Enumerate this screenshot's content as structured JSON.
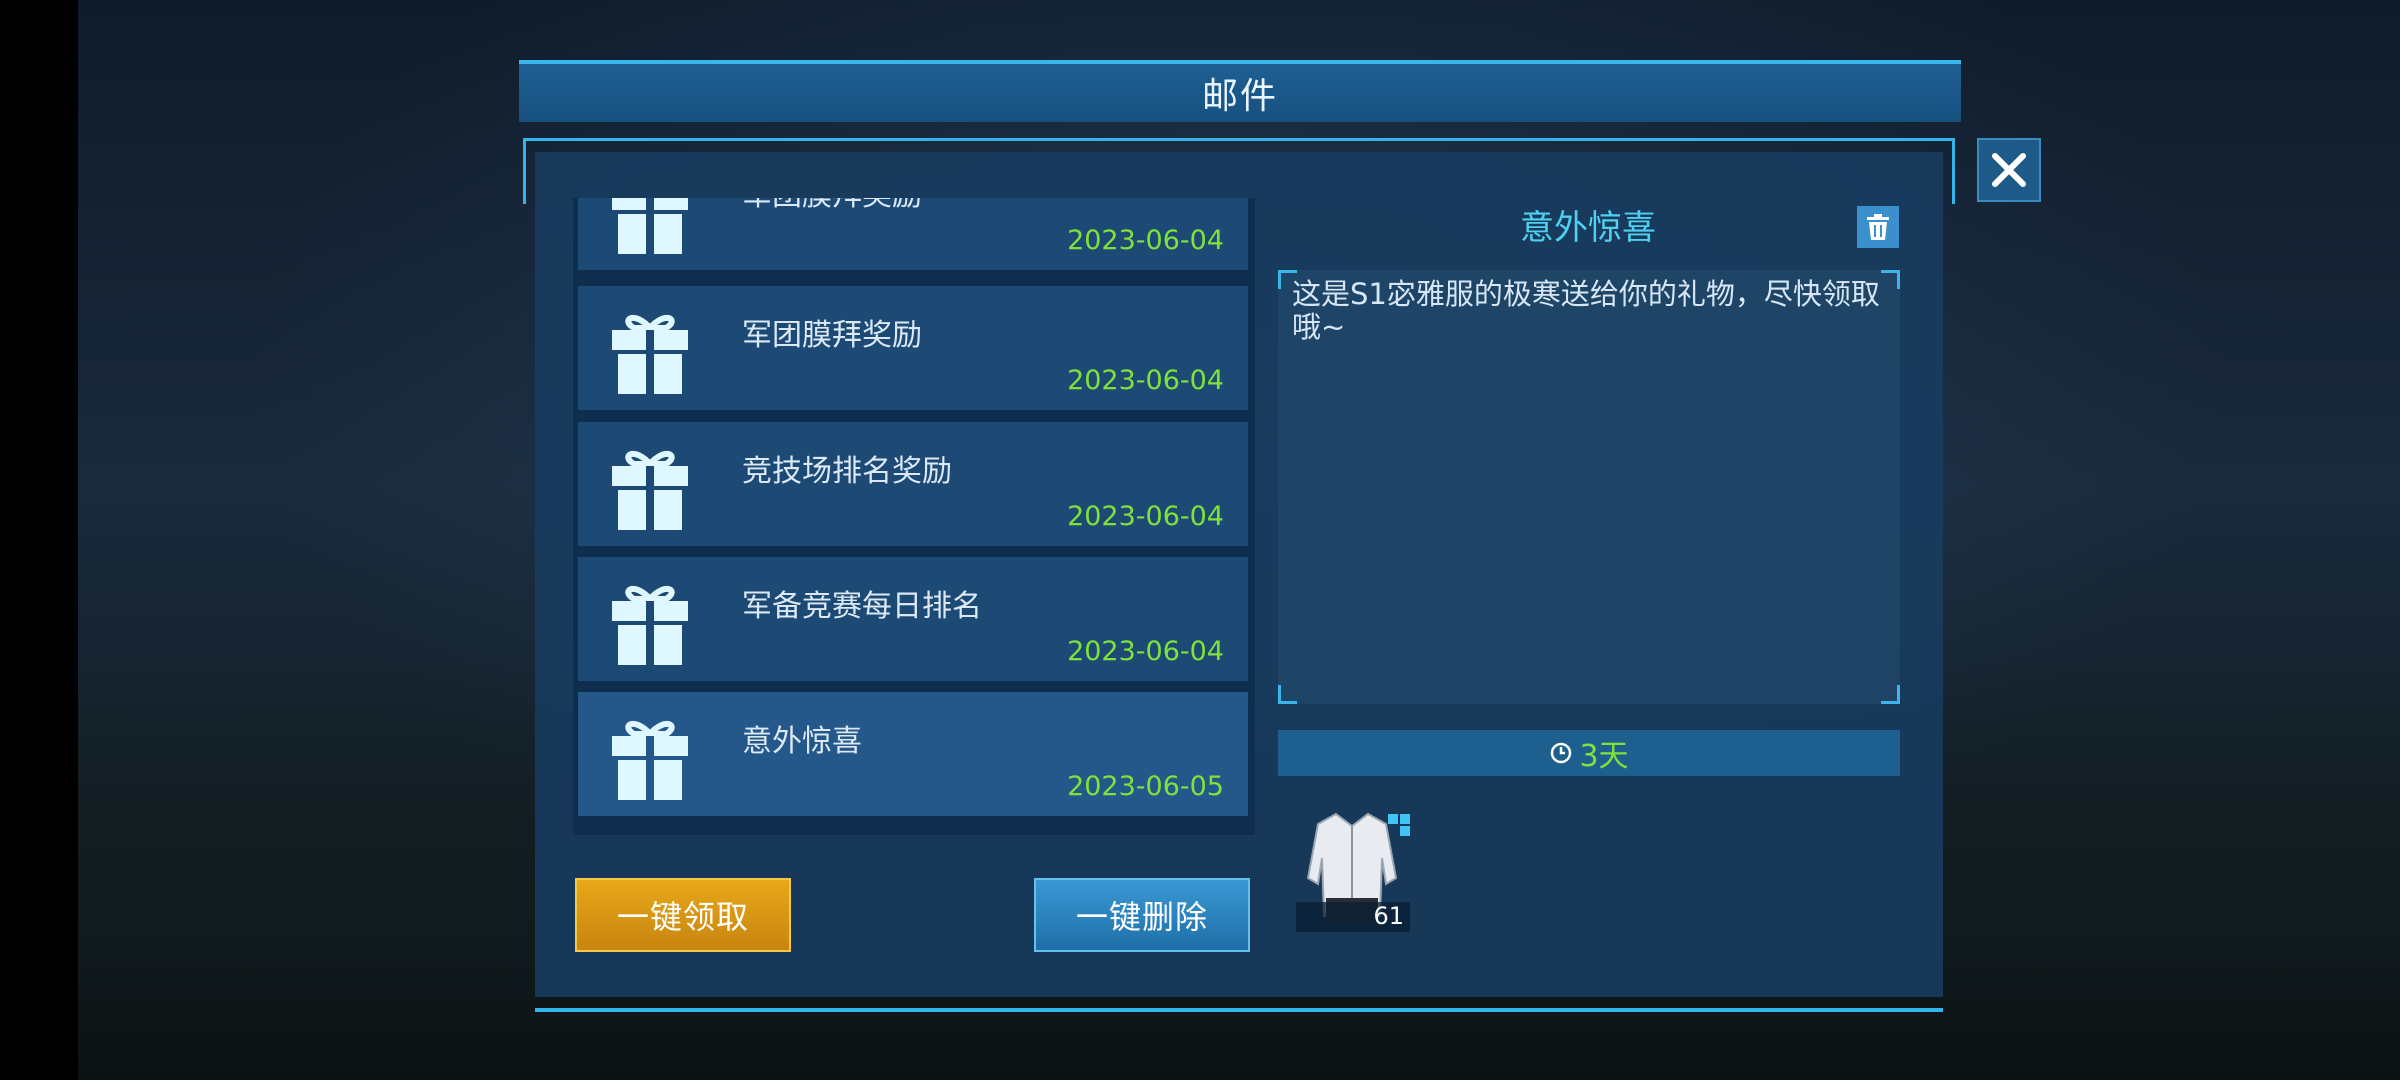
{
  "dialog": {
    "title": "邮件"
  },
  "mail_list": [
    {
      "name": "军团膜拜奖励",
      "date": "2023-06-04"
    },
    {
      "name": "军团膜拜奖励",
      "date": "2023-06-04"
    },
    {
      "name": "竞技场排名奖励",
      "date": "2023-06-04"
    },
    {
      "name": "军备竞赛每日排名",
      "date": "2023-06-04"
    },
    {
      "name": "意外惊喜",
      "date": "2023-06-05",
      "selected": true
    }
  ],
  "buttons": {
    "claim_all": "一键领取",
    "delete_all": "一键删除"
  },
  "detail": {
    "title": "意外惊喜",
    "message": "这是S1宓雅服的极寒送给你的礼物，尽快领取哦~",
    "expire": "3天",
    "attachment": {
      "icon": "white-jacket-outfit-icon",
      "count": "61"
    }
  },
  "colors": {
    "accent": "#33b4ea",
    "date_green": "#7ee23a",
    "title_cyan": "#4fd0f0",
    "claim_gold": "#e8a818",
    "delete_blue": "#2a86c4"
  }
}
